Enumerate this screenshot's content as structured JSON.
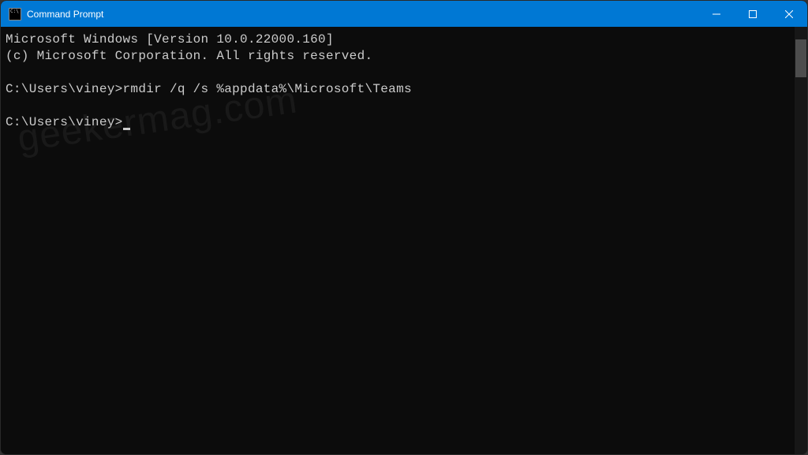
{
  "window": {
    "title": "Command Prompt"
  },
  "terminal": {
    "line1": "Microsoft Windows [Version 10.0.22000.160]",
    "line2": "(c) Microsoft Corporation. All rights reserved.",
    "blank1": "",
    "prompt1": "C:\\Users\\viney>",
    "command1": "rmdir /q /s %appdata%\\Microsoft\\Teams",
    "blank2": "",
    "prompt2": "C:\\Users\\viney>"
  },
  "watermark": "geekermag.com"
}
